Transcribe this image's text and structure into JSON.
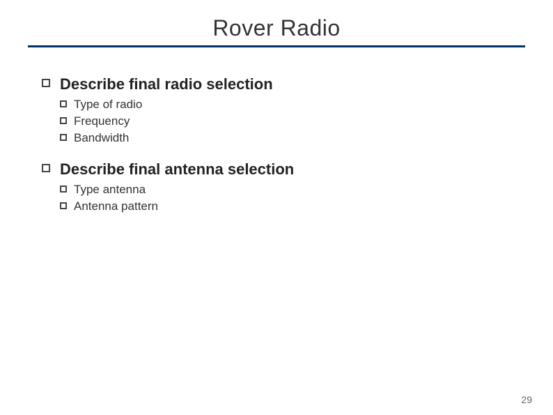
{
  "header": {
    "title": "Rover Radio"
  },
  "content": {
    "main_items": [
      {
        "label": "Describe final radio selection",
        "sub_items": [
          {
            "label": "Type of radio"
          },
          {
            "label": "Frequency"
          },
          {
            "label": "Bandwidth"
          }
        ]
      },
      {
        "label": "Describe final antenna selection",
        "sub_items": [
          {
            "label": "Type antenna"
          },
          {
            "label": "Antenna pattern"
          }
        ]
      }
    ]
  },
  "page_number": "29"
}
